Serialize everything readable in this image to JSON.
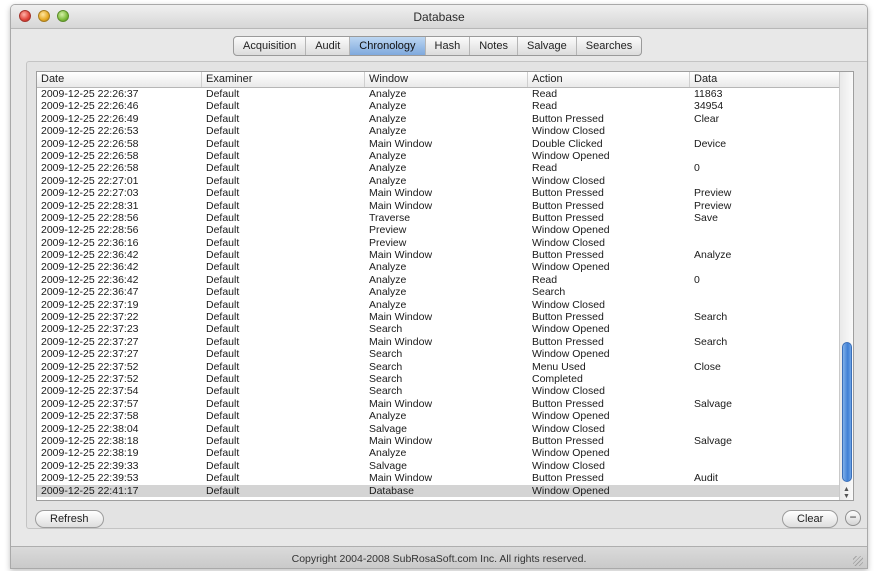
{
  "window": {
    "title": "Database"
  },
  "tabs": [
    "Acquisition",
    "Audit",
    "Chronology",
    "Hash",
    "Notes",
    "Salvage",
    "Searches"
  ],
  "active_tab": "Chronology",
  "columns": [
    "Date",
    "Examiner",
    "Window",
    "Action",
    "Data"
  ],
  "rows": [
    [
      "2009-12-25 22:26:37",
      "Default",
      "Analyze",
      "Read",
      "11863"
    ],
    [
      "2009-12-25 22:26:46",
      "Default",
      "Analyze",
      "Read",
      "34954"
    ],
    [
      "2009-12-25 22:26:49",
      "Default",
      "Analyze",
      "Button Pressed",
      "Clear"
    ],
    [
      "2009-12-25 22:26:53",
      "Default",
      "Analyze",
      "Window Closed",
      ""
    ],
    [
      "2009-12-25 22:26:58",
      "Default",
      "Main Window",
      "Double Clicked",
      "Device"
    ],
    [
      "2009-12-25 22:26:58",
      "Default",
      "Analyze",
      "Window Opened",
      ""
    ],
    [
      "2009-12-25 22:26:58",
      "Default",
      "Analyze",
      "Read",
      "0"
    ],
    [
      "2009-12-25 22:27:01",
      "Default",
      "Analyze",
      "Window Closed",
      ""
    ],
    [
      "2009-12-25 22:27:03",
      "Default",
      "Main Window",
      "Button Pressed",
      "Preview"
    ],
    [
      "2009-12-25 22:28:31",
      "Default",
      "Main Window",
      "Button Pressed",
      "Preview"
    ],
    [
      "2009-12-25 22:28:56",
      "Default",
      "Traverse",
      "Button Pressed",
      "Save"
    ],
    [
      "2009-12-25 22:28:56",
      "Default",
      "Preview",
      "Window Opened",
      ""
    ],
    [
      "2009-12-25 22:36:16",
      "Default",
      "Preview",
      "Window Closed",
      ""
    ],
    [
      "2009-12-25 22:36:42",
      "Default",
      "Main Window",
      "Button Pressed",
      "Analyze"
    ],
    [
      "2009-12-25 22:36:42",
      "Default",
      "Analyze",
      "Window Opened",
      ""
    ],
    [
      "2009-12-25 22:36:42",
      "Default",
      "Analyze",
      "Read",
      "0"
    ],
    [
      "2009-12-25 22:36:47",
      "Default",
      "Analyze",
      "Search",
      ""
    ],
    [
      "2009-12-25 22:37:19",
      "Default",
      "Analyze",
      "Window Closed",
      ""
    ],
    [
      "2009-12-25 22:37:22",
      "Default",
      "Main Window",
      "Button Pressed",
      "Search"
    ],
    [
      "2009-12-25 22:37:23",
      "Default",
      "Search",
      "Window Opened",
      ""
    ],
    [
      "2009-12-25 22:37:27",
      "Default",
      "Main Window",
      "Button Pressed",
      "Search"
    ],
    [
      "2009-12-25 22:37:27",
      "Default",
      "Search",
      "Window Opened",
      ""
    ],
    [
      "2009-12-25 22:37:52",
      "Default",
      "Search",
      "Menu Used",
      "Close"
    ],
    [
      "2009-12-25 22:37:52",
      "Default",
      "Search",
      "Completed",
      ""
    ],
    [
      "2009-12-25 22:37:54",
      "Default",
      "Search",
      "Window Closed",
      ""
    ],
    [
      "2009-12-25 22:37:57",
      "Default",
      "Main Window",
      "Button Pressed",
      "Salvage"
    ],
    [
      "2009-12-25 22:37:58",
      "Default",
      "Analyze",
      "Window Opened",
      ""
    ],
    [
      "2009-12-25 22:38:04",
      "Default",
      "Salvage",
      "Window Closed",
      ""
    ],
    [
      "2009-12-25 22:38:18",
      "Default",
      "Main Window",
      "Button Pressed",
      "Salvage"
    ],
    [
      "2009-12-25 22:38:19",
      "Default",
      "Analyze",
      "Window Opened",
      ""
    ],
    [
      "2009-12-25 22:39:33",
      "Default",
      "Salvage",
      "Window Closed",
      ""
    ],
    [
      "2009-12-25 22:39:53",
      "Default",
      "Main Window",
      "Button Pressed",
      "Audit"
    ],
    [
      "2009-12-25 22:41:17",
      "Default",
      "Database",
      "Window Opened",
      ""
    ]
  ],
  "selected_row": 32,
  "buttons": {
    "refresh": "Refresh",
    "clear": "Clear",
    "minus": "−"
  },
  "footer": "Copyright 2004-2008 SubRosaSoft.com Inc. All rights reserved.",
  "colors": {
    "accent": "#7fa9dd",
    "scroll_thumb": "#3f7fd4",
    "selected_row": "#d4d4d4"
  }
}
